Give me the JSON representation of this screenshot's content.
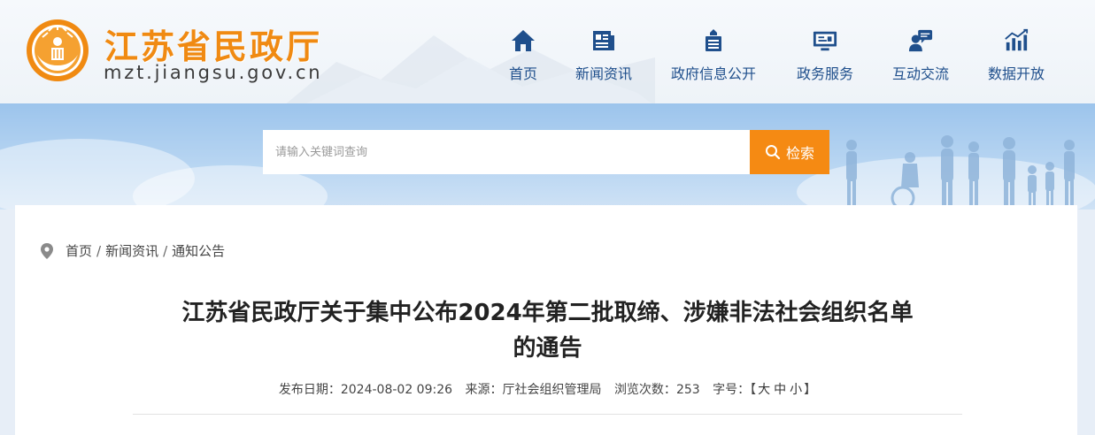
{
  "header": {
    "site_name": "江苏省民政厅",
    "site_domain": "mzt.jiangsu.gov.cn",
    "brand_color": "#f08a12",
    "nav_color": "#1f4f8c"
  },
  "nav": [
    {
      "label": "首页",
      "icon": "home-icon"
    },
    {
      "label": "新闻资讯",
      "icon": "news-icon"
    },
    {
      "label": "政府信息公开",
      "icon": "government-building-icon"
    },
    {
      "label": "政务服务",
      "icon": "service-screen-icon"
    },
    {
      "label": "互动交流",
      "icon": "chat-user-icon"
    },
    {
      "label": "数据开放",
      "icon": "bar-chart-icon"
    }
  ],
  "search": {
    "placeholder": "请输入关键词查询",
    "button_label": "检索",
    "button_color": "#f58a13"
  },
  "breadcrumb": {
    "items": [
      "首页",
      "新闻资讯",
      "通知公告"
    ],
    "separator": "/"
  },
  "article": {
    "title_line1": "江苏省民政厅关于集中公布2024年第二批取缔、涉嫌非法社会组织名单",
    "title_line2": "的通告",
    "date_label": "发布日期：",
    "date_value": "2024-08-02 09:26",
    "source_label": "来源：",
    "source_value": "厅社会组织管理局",
    "views_label": "浏览次数：",
    "views_value": "253",
    "fontsize_label": "字号：",
    "fontsize_open": "【",
    "fontsize_large": "大",
    "fontsize_medium": "中",
    "fontsize_small": "小",
    "fontsize_close": "】"
  }
}
